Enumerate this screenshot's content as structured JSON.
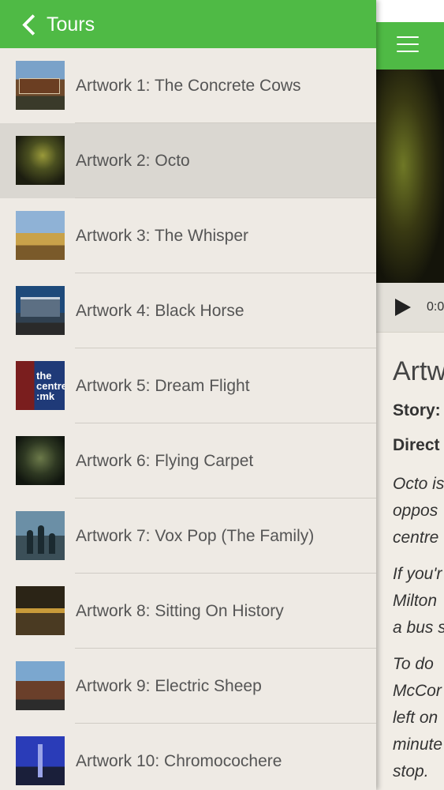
{
  "drawer": {
    "back_label": "Tours",
    "items": [
      {
        "label": "Artwork 1: The Concrete Cows",
        "thumb_text": "Milton Keynes Museum",
        "selected": false
      },
      {
        "label": "Artwork 2: Octo",
        "selected": true
      },
      {
        "label": "Artwork 3: The Whisper",
        "selected": false
      },
      {
        "label": "Artwork 4: Black Horse",
        "selected": false
      },
      {
        "label": "Artwork 5: Dream Flight",
        "thumb_text": "the centre :mk",
        "selected": false
      },
      {
        "label": "Artwork 6: Flying Carpet",
        "selected": false
      },
      {
        "label": "Artwork 7: Vox Pop (The Family)",
        "selected": false
      },
      {
        "label": "Artwork 8: Sitting On History",
        "selected": false
      },
      {
        "label": "Artwork 9: Electric Sheep",
        "selected": false
      },
      {
        "label": "Artwork 10: Chromocochere",
        "selected": false
      }
    ]
  },
  "detail": {
    "audio_time": "0:0",
    "title": "Artw",
    "story_label": "Story:",
    "directions_label": "Direct",
    "paragraphs": [
      [
        "Octo is",
        "oppos",
        "centre"
      ],
      [
        "If you'r",
        "Milton",
        "a bus s"
      ],
      [
        "To do",
        "McCor",
        "left on",
        "minute",
        "stop."
      ]
    ]
  },
  "colors": {
    "header_green": "#4fba45",
    "drawer_bg": "#eeeae4",
    "selected_bg": "#dad7d1"
  }
}
